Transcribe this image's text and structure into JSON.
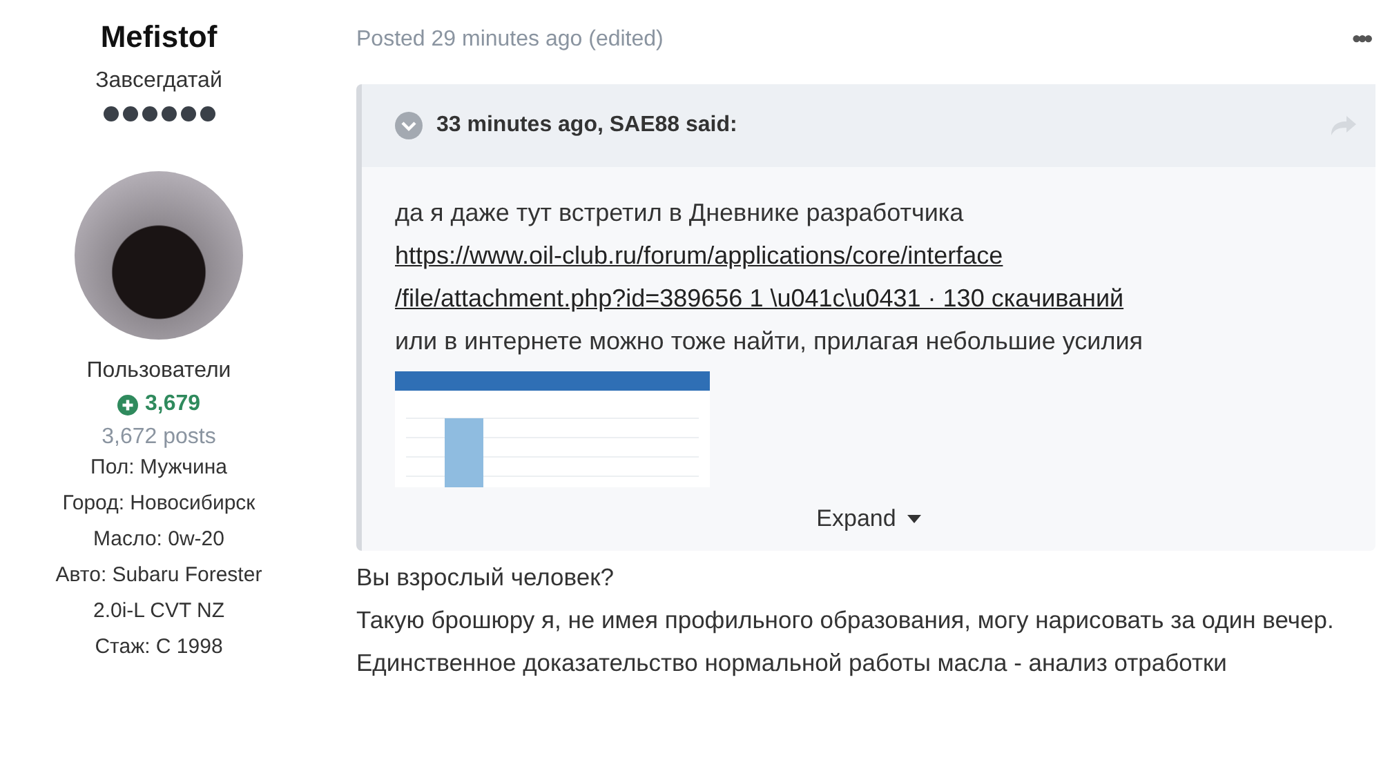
{
  "author": {
    "name": "Mefistof",
    "title": "Завсегдатай",
    "group": "Пользователи",
    "reputation": "3,679",
    "posts": "3,672 posts",
    "fields": [
      "Пол: Мужчина",
      "Город: Новосибирск",
      "Масло: 0w-20",
      "Авто: Subaru Forester 2.0i-L CVT NZ",
      "Стаж: С 1998"
    ]
  },
  "post": {
    "meta": "Posted 29 minutes ago (edited)",
    "menu": "•••",
    "quote": {
      "header": "33 minutes ago, SAE88 said:",
      "lines": [
        {
          "kind": "text",
          "text": "да я даже тут встретил в Дневнике разработчика"
        },
        {
          "kind": "link",
          "text": "https://www.oil-club.ru/forum/applications/core/interface\n/file/attachment.php?id=389656 1 \\u041c\\u0431 · 130 скачиваний"
        },
        {
          "kind": "text",
          "text": "или в интернете можно тоже найти, прилагая небольшие усилия"
        },
        {
          "kind": "image"
        }
      ],
      "expand": "Expand"
    },
    "paragraphs": [
      "Вы взрослый человек?",
      "Такую брошюру я, не имея профильного образования, могу нарисовать за один вечер.",
      "Единственное доказательство нормальной работы масла - анализ отработки"
    ]
  }
}
